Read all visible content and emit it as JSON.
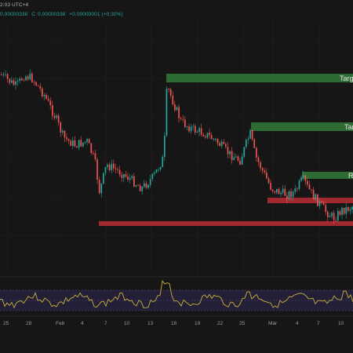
{
  "header": {
    "clock": "2:03 UTC+4",
    "ohlc": {
      "high": "0.00000338",
      "close_label": "C",
      "close": "0.00000338",
      "change": "+0.00000001 (+0.30%)"
    }
  },
  "zones": [
    {
      "label": "Targ",
      "kind": "target",
      "color": "#2e6b32"
    },
    {
      "label": "Tar",
      "kind": "target",
      "color": "#2e6b32"
    },
    {
      "label": "R",
      "kind": "resistance",
      "color": "#2e6b32"
    },
    {
      "label": "",
      "kind": "support",
      "color": "#a0282e"
    },
    {
      "label": "",
      "kind": "support",
      "color": "#a0282e"
    }
  ],
  "x_axis": {
    "labels": [
      "25",
      "28",
      "Feb",
      "4",
      "7",
      "10",
      "13",
      "16",
      "19",
      "22",
      "25",
      "Mar",
      "4",
      "7",
      "10"
    ]
  },
  "colors": {
    "bull": "#26a69a",
    "bear": "#ef5350",
    "oscillator": "#c9b23a",
    "oscillator_band": "#3a2f5c"
  }
}
